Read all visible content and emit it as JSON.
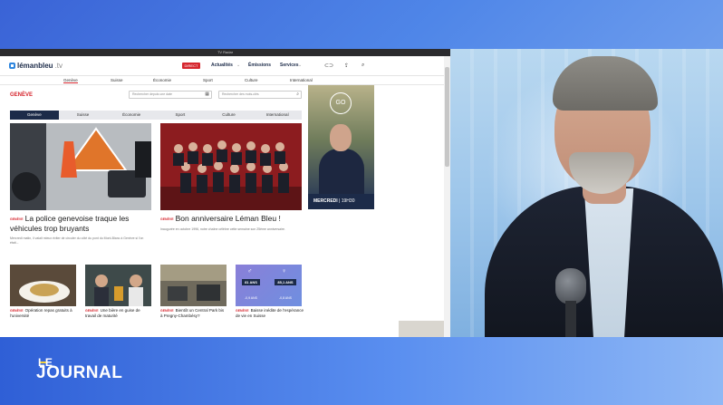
{
  "browser": {
    "window_title": "TV Radar",
    "logo": {
      "name": "lémanbleu",
      "suffix": ".tv"
    },
    "direct_label": "DIRECT",
    "top_nav": [
      "Actualités",
      "Émissions",
      "Services"
    ],
    "sub_nav": [
      "Genève",
      "Suisse",
      "Économie",
      "Sport",
      "Culture",
      "International"
    ],
    "section_title": "GENÈVE",
    "search_date_placeholder": "Rechercher depuis une date",
    "search_keyword_placeholder": "Rechercher des mots-clés",
    "tabs": [
      "Genève",
      "Suisse",
      "Économie",
      "Sport",
      "Culture",
      "International"
    ],
    "active_tab": "Genève",
    "kicker": "GENÈVE",
    "articles_big": [
      {
        "headline": "La police genevoise traque les véhicules trop bruyants",
        "excerpt": "Mercredi matin, il valait mieux éviter de circuler du côté du pont du Mont-Blanc à Genève si l'on était..."
      },
      {
        "headline": "Bon anniversaire Léman Bleu !",
        "excerpt": "Inaugurée en octobre 1996, notre chaîne célèbre cette semaine son 25ème anniversaire."
      }
    ],
    "articles_small": [
      {
        "headline": "Opération repas gratuits à l'université"
      },
      {
        "headline": "Une bière en guise de travail de maturité"
      },
      {
        "headline": "Bientôt un Central Park bis à Pregny-Chambésy?"
      },
      {
        "headline": "Baisse inédite de l'espérance de vie en Suisse"
      }
    ],
    "stat_card": {
      "left_value": "81 ANS",
      "right_value": "85,1 ANS",
      "left_sub": "-0,9 ANS",
      "right_sub": "-0,8 ANS"
    },
    "ad": {
      "logo": "GO",
      "day": "MERCREDI",
      "time": "19H30"
    }
  },
  "lower_third": {
    "line1": "LE",
    "line2": "JOURNAL",
    "accent_color": "#f4d23a"
  },
  "colors": {
    "brand_red": "#d6262e",
    "brand_navy": "#1c2b49"
  }
}
